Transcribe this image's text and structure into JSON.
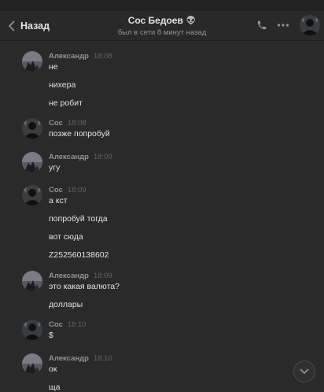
{
  "header": {
    "back_label": "Назад",
    "contact_name": "Сос Бедоев",
    "name_emoji": "👽",
    "status": "был в сети 8 минут назад"
  },
  "groups": [
    {
      "author": "Александр",
      "time": "18:08",
      "avatar": "alexander",
      "lines": [
        "не",
        "нихера",
        "не робит"
      ]
    },
    {
      "author": "Сос",
      "time": "18:08",
      "avatar": "sos",
      "lines": [
        "позже попробуй"
      ]
    },
    {
      "author": "Александр",
      "time": "18:09",
      "avatar": "alexander",
      "lines": [
        "угу"
      ]
    },
    {
      "author": "Сос",
      "time": "18:09",
      "avatar": "sos",
      "lines": [
        "а кст",
        "попробуй тогда",
        "вот сюда",
        "Z252560138602"
      ]
    },
    {
      "author": "Александр",
      "time": "18:09",
      "avatar": "alexander",
      "lines": [
        "это какая валюта?",
        "доллары"
      ]
    },
    {
      "author": "Сос",
      "time": "18:10",
      "avatar": "sos",
      "lines": [
        "$"
      ]
    },
    {
      "author": "Александр",
      "time": "18:10",
      "avatar": "alexander",
      "lines": [
        "ок",
        "ща"
      ]
    }
  ],
  "colors": {
    "background": "#2a2a2a",
    "header": "#292929",
    "text": "#e1e3e6",
    "author": "#8f9399",
    "time": "#5f6368"
  },
  "icons": [
    "back-chevron-icon",
    "phone-icon",
    "more-icon",
    "scroll-down-icon"
  ]
}
